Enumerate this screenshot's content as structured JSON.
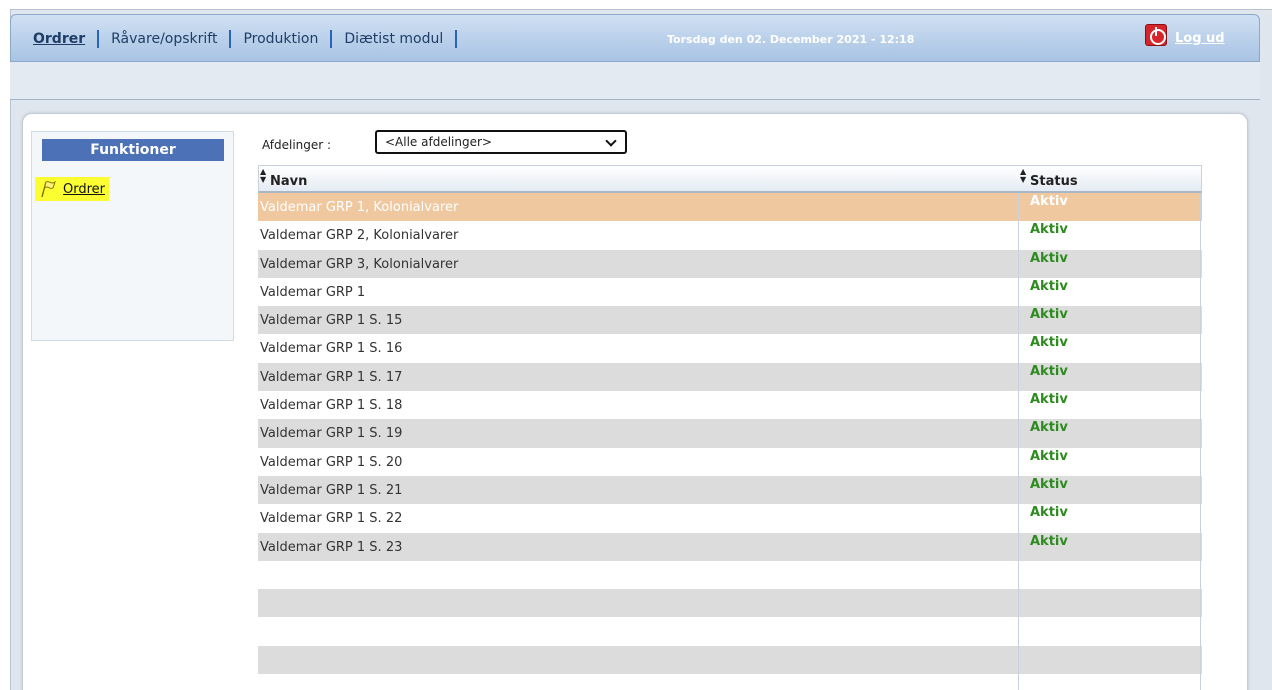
{
  "nav": {
    "items": [
      {
        "label": "Ordrer",
        "active": true
      },
      {
        "label": "Råvare/opskrift",
        "active": false
      },
      {
        "label": "Produktion",
        "active": false
      },
      {
        "label": "Diætist modul",
        "active": false
      }
    ],
    "datetime": "Torsdag den 02. December 2021 -  12:18",
    "logout_label": "Log ud",
    "logout_icon": "power-icon"
  },
  "sidebar": {
    "title": "Funktioner",
    "items": [
      {
        "label": "Ordrer",
        "icon": "flag-icon",
        "highlighted": true
      }
    ]
  },
  "filter": {
    "label": "Afdelinger :",
    "selected": "<Alle afdelinger>"
  },
  "grid": {
    "headers": {
      "navn": "Navn",
      "status": "Status"
    },
    "rows": [
      {
        "navn": "Valdemar GRP 1, Kolonialvarer",
        "status": "Aktiv",
        "selected": true
      },
      {
        "navn": "Valdemar GRP 2, Kolonialvarer",
        "status": "Aktiv"
      },
      {
        "navn": "Valdemar GRP 3, Kolonialvarer",
        "status": "Aktiv"
      },
      {
        "navn": "Valdemar GRP 1",
        "status": "Aktiv"
      },
      {
        "navn": "Valdemar GRP 1 S. 15",
        "status": "Aktiv"
      },
      {
        "navn": "Valdemar GRP 1 S. 16",
        "status": "Aktiv"
      },
      {
        "navn": "Valdemar GRP 1 S. 17",
        "status": "Aktiv"
      },
      {
        "navn": "Valdemar GRP 1 S. 18",
        "status": "Aktiv"
      },
      {
        "navn": "Valdemar GRP 1 S. 19",
        "status": "Aktiv"
      },
      {
        "navn": "Valdemar GRP 1 S. 20",
        "status": "Aktiv"
      },
      {
        "navn": "Valdemar GRP 1 S. 21",
        "status": "Aktiv"
      },
      {
        "navn": "Valdemar GRP 1 S. 22",
        "status": "Aktiv"
      },
      {
        "navn": "Valdemar GRP 1 S. 23",
        "status": "Aktiv"
      },
      {
        "navn": "",
        "status": ""
      },
      {
        "navn": "",
        "status": ""
      },
      {
        "navn": "",
        "status": ""
      },
      {
        "navn": "",
        "status": ""
      },
      {
        "navn": "",
        "status": ""
      }
    ]
  },
  "colors": {
    "selected_row": "#f0c8a0",
    "status_active": "#2e8b20",
    "sidebar_header": "#4c71b6",
    "highlight": "#fbff31"
  }
}
